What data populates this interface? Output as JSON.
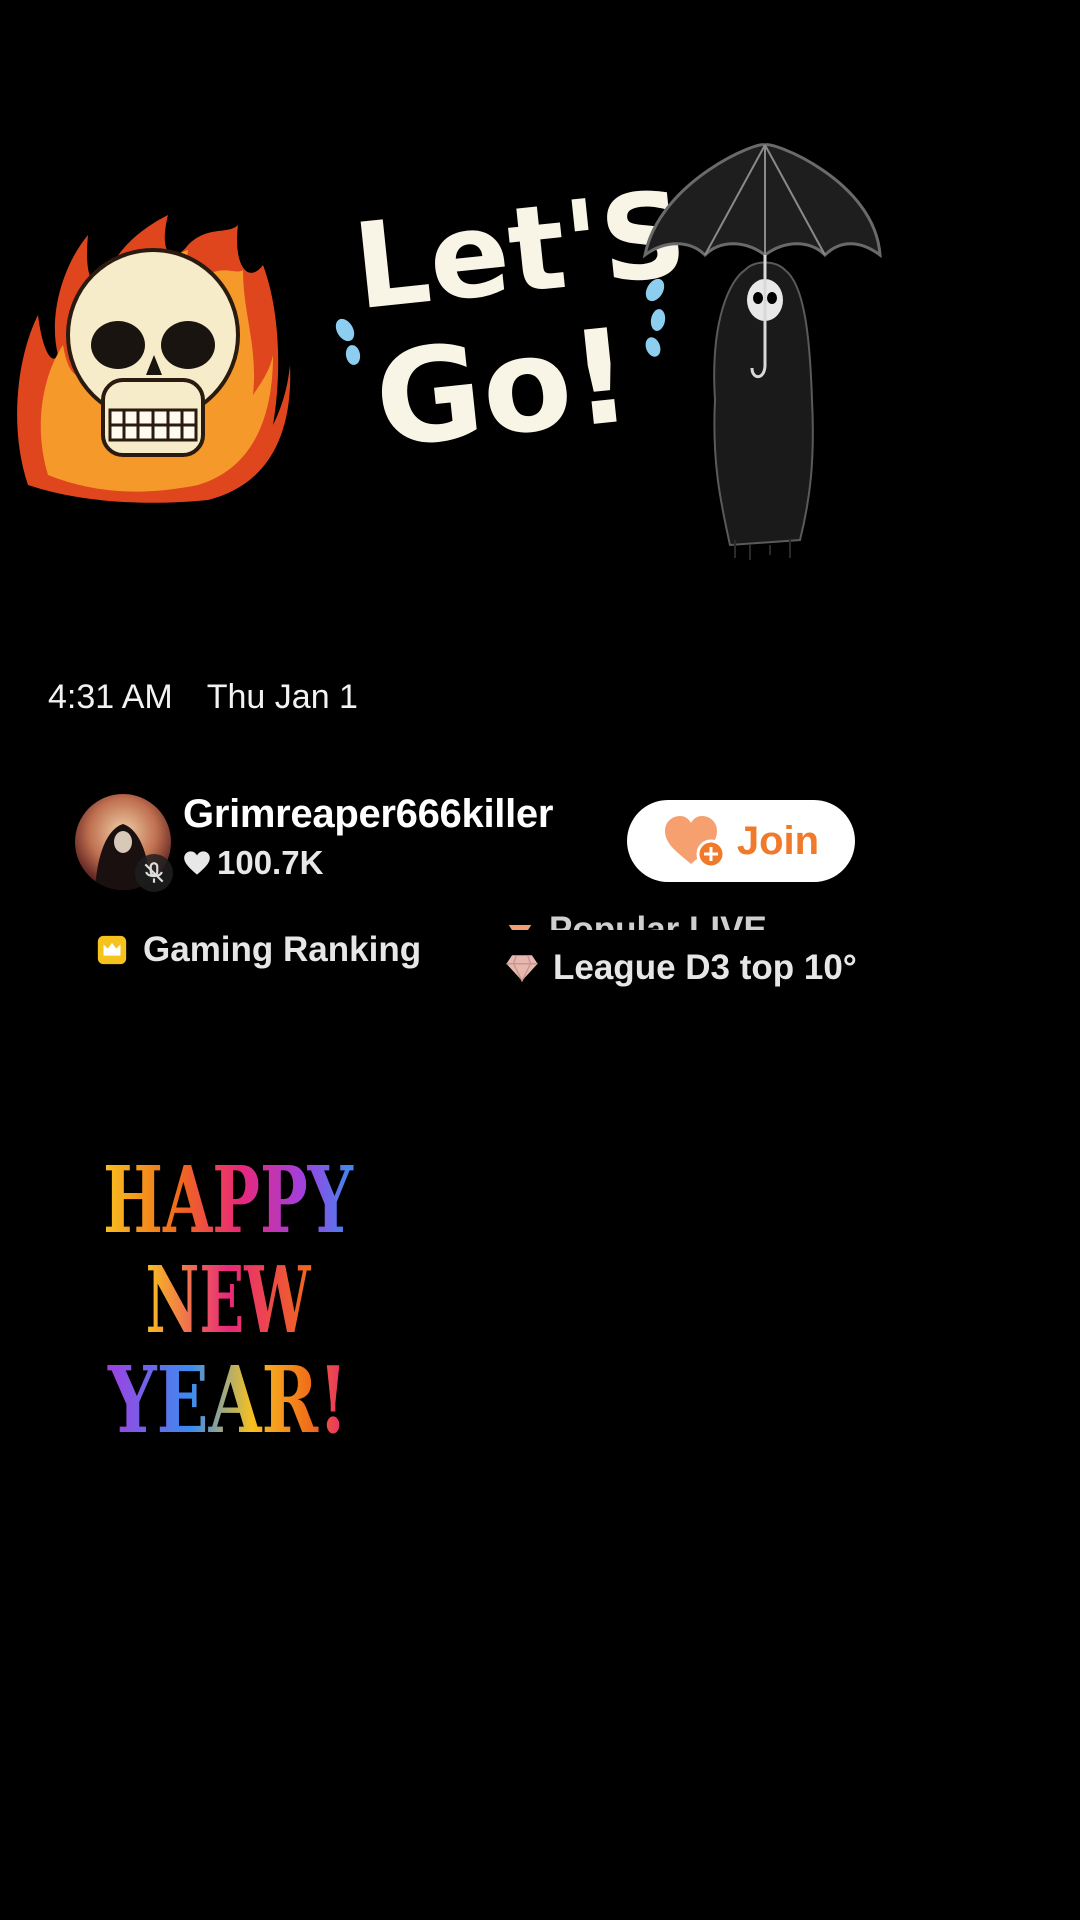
{
  "stickers": {
    "lets_go": {
      "line1": "Let'S",
      "line2": "Go!"
    },
    "happy_new_year": {
      "line1": "HAPPY",
      "line2": "NEW",
      "line3": "YEAR!"
    }
  },
  "status": {
    "time": "4:31 AM",
    "date": "Thu Jan 1"
  },
  "host": {
    "username": "Grimreaper666killer",
    "likes": "100.7K",
    "join_label": "Join"
  },
  "rankings": {
    "gaming": "Gaming Ranking",
    "popular_live": "Popular LIVE",
    "league": "League D3 top 10°"
  },
  "colors": {
    "background": "#000000",
    "join_text": "#f07a2a",
    "join_background": "#ffffff"
  }
}
